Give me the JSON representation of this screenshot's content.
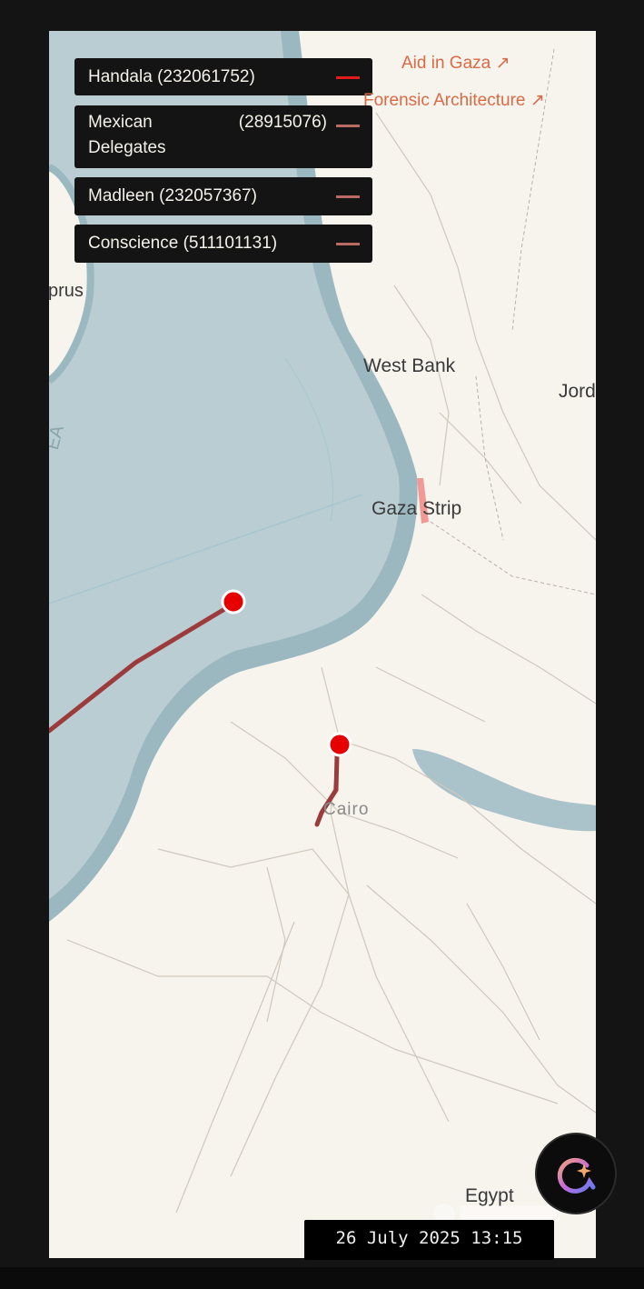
{
  "vessels": [
    {
      "name": "Handala",
      "mmsi": "(232061752)",
      "color": "#e21b1b"
    },
    {
      "name": "Mexican Delegates",
      "mmsi": "(28915076)",
      "color": "#b86a63"
    },
    {
      "name": "Madleen",
      "mmsi": "(232057367)",
      "color": "#b86a63"
    },
    {
      "name": "Conscience",
      "mmsi": "(511101131)",
      "color": "#b86a63"
    }
  ],
  "links": {
    "aid_in_gaza": "Aid in Gaza ↗",
    "forensic_architecture": "Forensic Architecture ↗"
  },
  "map": {
    "labels": {
      "cyprus": "prus",
      "sea": "EA",
      "west_bank": "West Bank",
      "jordan": "Jord",
      "gaza_strip": "Gaza Strip",
      "cairo": "Cairo",
      "egypt": "Egypt"
    },
    "colors": {
      "land": "#f7f3ed",
      "sea": "#b9cdd3",
      "coast_band": "#9bb8c1",
      "track": "#9c3b3b",
      "vessel_marker": "#e60000",
      "gaza_highlight": "#f19a95"
    }
  },
  "timestamp": "26 July 2025 13:15",
  "icons": {
    "assistant": "sparkle-assistant-icon",
    "attribution": "mapbox-logo"
  }
}
